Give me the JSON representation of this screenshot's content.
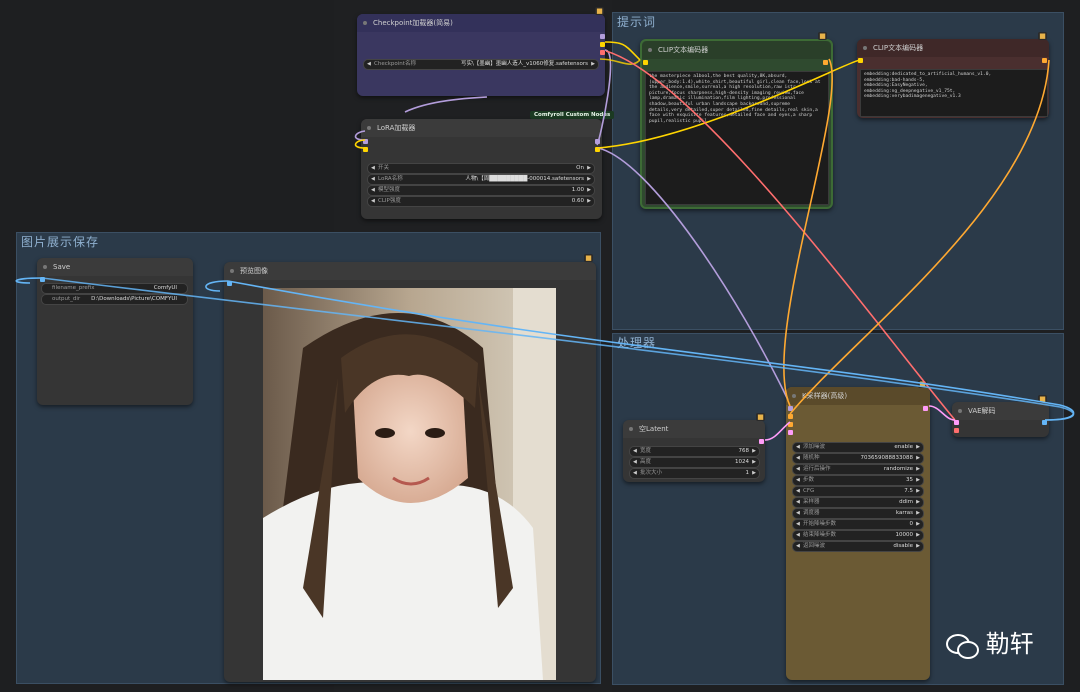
{
  "groups": {
    "prompt": "提示词",
    "image_display": "图片展示保存",
    "processor": "处理器"
  },
  "checkpoint_node": {
    "title": "Checkpoint加载器(简易)",
    "widget_label": "Checkpoint名称",
    "widget_value": "写实\\【墨幽】墨幽人造人_v1060修复.safetensors"
  },
  "custom_tag": "Comfyroll Custom Nodes",
  "lora_node": {
    "title": "LoRA加载器",
    "widgets": [
      {
        "label": "开关",
        "value": "On"
      },
      {
        "label": "LoRA名称",
        "value": "人物\\【周█████████-000014.safetensors"
      },
      {
        "label": "模型强度",
        "value": "1.00"
      },
      {
        "label": "CLIP强度",
        "value": "0.60"
      }
    ]
  },
  "clip_pos_node": {
    "title": "CLIP文本编码器",
    "text": "the masterpiece a1boo1,the best quality,8K,absurd,\n(upper_body:1.4),white_shirt,beautiful girl,clean face,look at the audience,smile,surreal,a high resolution,raw istr picture,focus sharpness,high-density imaging review,face lamp,dramatic illumination,film lighting,professional shadow,beautiful urban landscape background,supreme details,very detailed,super detailed,fine details,real skin,a face with exquisite features,detailed face and eyes,a sharp pupil,realistic pupil,"
  },
  "clip_neg_node": {
    "title": "CLIP文本编码器",
    "text": "embedding:dedicated_to_artificial_humans_v1.0,\nembedding:bad-hands-5,\nembedding:EasyNegative,\nembedding:ng_deepnegative_v1_75t,\nembedding:verybadimagenegative_v1.3"
  },
  "save_node": {
    "title": "Save",
    "widgets": [
      {
        "label": "filename_prefix",
        "value": "ComfyUI"
      },
      {
        "label": "output_dir",
        "value": "D:\\Downloads\\Picture\\COMFYUI"
      }
    ]
  },
  "preview_node": {
    "title": "预览图像"
  },
  "latent_node": {
    "title": "空Latent",
    "widgets": [
      {
        "label": "宽度",
        "value": "768"
      },
      {
        "label": "高度",
        "value": "1024"
      },
      {
        "label": "批次大小",
        "value": "1"
      }
    ]
  },
  "ksampler_node": {
    "title": "K采样器(高级)",
    "widgets": [
      {
        "label": "添加噪波",
        "value": "enable"
      },
      {
        "label": "随机种",
        "value": "703659088833088"
      },
      {
        "label": "运行后操作",
        "value": "randomize"
      },
      {
        "label": "步数",
        "value": "35"
      },
      {
        "label": "CFG",
        "value": "7.5"
      },
      {
        "label": "采样器",
        "value": "ddim"
      },
      {
        "label": "调度器",
        "value": "karras"
      },
      {
        "label": "开始降噪步数",
        "value": "0"
      },
      {
        "label": "结束降噪步数",
        "value": "10000"
      },
      {
        "label": "返回噪波",
        "value": "disable"
      }
    ]
  },
  "vae_node": {
    "title": "VAE解码"
  },
  "watermark": "勒轩",
  "colors": {
    "model_port": "#b39ddb",
    "clip_port": "#ffd500",
    "vae_port": "#ff6e6e",
    "latent_port": "#ff9cf9",
    "image_port": "#64b5f6",
    "cond_port": "#ffa931"
  }
}
